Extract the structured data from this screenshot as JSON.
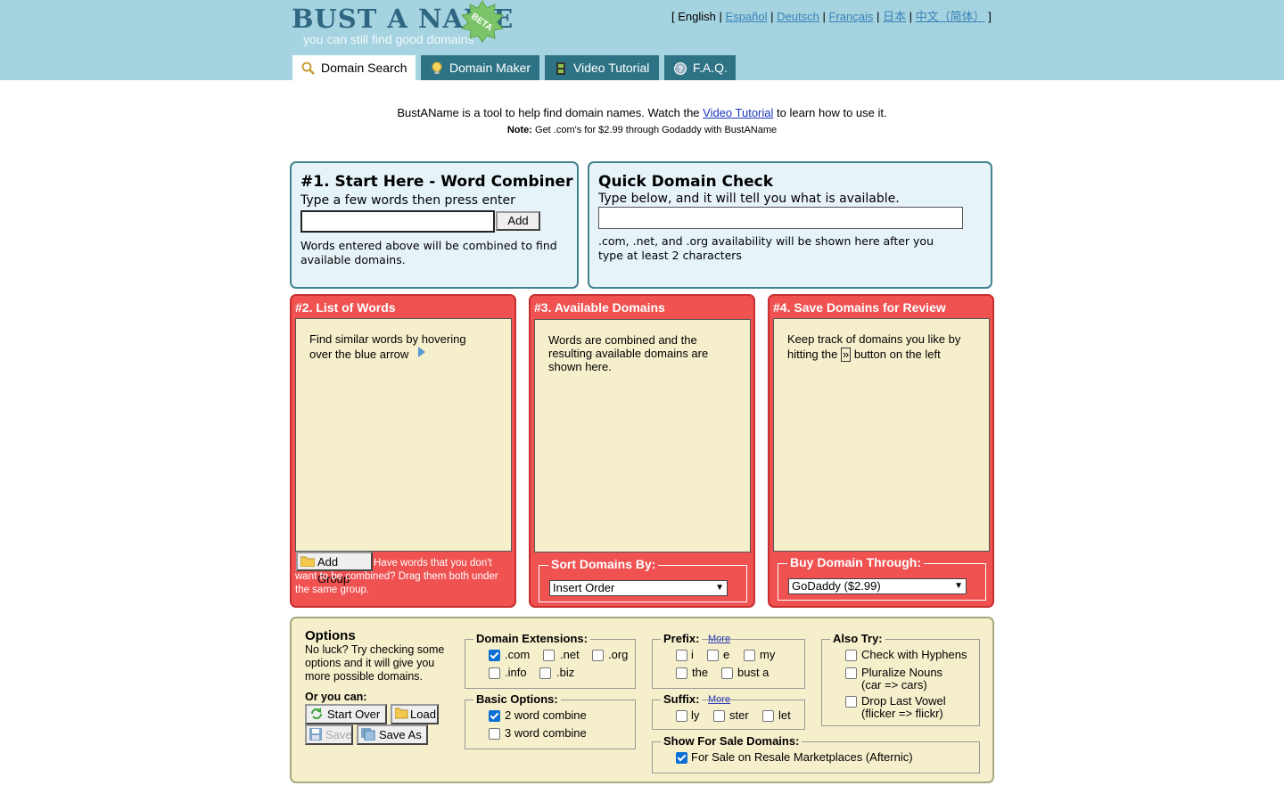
{
  "logo": {
    "main": "BUST A NAME",
    "tagline": "you can still find good domains",
    "badge": "BETA"
  },
  "languages": {
    "open": "[",
    "current": "English",
    "sep": "|",
    "items": [
      "Español",
      "Deutsch",
      "Français",
      "日本",
      "中文（简体）"
    ],
    "close": "]"
  },
  "tabs": [
    {
      "label": "Domain Search",
      "icon": "magnifier-icon"
    },
    {
      "label": "Domain Maker",
      "icon": "lightbulb-icon"
    },
    {
      "label": "Video Tutorial",
      "icon": "film-icon"
    },
    {
      "label": "F.A.Q.",
      "icon": "help-icon"
    }
  ],
  "intro": {
    "before": "BustAName is a tool to help find domain names. Watch the ",
    "link": "Video Tutorial",
    "after": " to learn how to use it."
  },
  "note": {
    "label": "Note:",
    "text": " Get .com's for $2.99 through Godaddy with BustAName"
  },
  "word_combiner": {
    "title": "#1. Start Here - Word Combiner",
    "subtitle": "Type a few words then press enter",
    "add": "Add",
    "desc": "Words entered above will be combined to find available domains."
  },
  "quick_check": {
    "title": "Quick Domain Check",
    "subtitle": "Type below, and it will tell you what is available.",
    "desc": ".com, .net, and .org availability will be shown here after you type at least 2 characters"
  },
  "list_words": {
    "title": "#2. List of Words",
    "hint": "Find similar words by hovering over the blue arrow",
    "add_group": "Add Group",
    "footer": "Have words that you don't want to be combined?  Drag them both under the same group."
  },
  "available": {
    "title": "#3. Available Domains",
    "hint": "Words are combined and the resulting available domains are shown here.",
    "sort_legend": "Sort Domains By:",
    "sort_value": "Insert Order"
  },
  "save_review": {
    "title": "#4. Save Domains for Review",
    "hint_before": "Keep track of domains you like by hitting the",
    "button": "»",
    "hint_after": "button on the left",
    "buy_legend": "Buy Domain Through:",
    "buy_value": "GoDaddy ($2.99)"
  },
  "options": {
    "title": "Options",
    "desc": "No luck?  Try checking some options and it will give you more possible domains.",
    "or_you_can": "Or you can:",
    "buttons": {
      "start_over": "Start Over",
      "load": "Load",
      "save": "Save",
      "save_as": "Save As"
    },
    "extensions": {
      "legend": "Domain Extensions:",
      "items": [
        {
          "label": ".com",
          "checked": true
        },
        {
          "label": ".net",
          "checked": false
        },
        {
          "label": ".org",
          "checked": false
        },
        {
          "label": ".info",
          "checked": false
        },
        {
          "label": ".biz",
          "checked": false
        }
      ]
    },
    "basic": {
      "legend": "Basic Options:",
      "items": [
        {
          "label": "2 word combine",
          "checked": true
        },
        {
          "label": "3 word combine",
          "checked": false
        }
      ]
    },
    "prefix": {
      "legend": "Prefix:",
      "more": "More",
      "items": [
        {
          "label": "i",
          "checked": false
        },
        {
          "label": "e",
          "checked": false
        },
        {
          "label": "my",
          "checked": false
        },
        {
          "label": "the",
          "checked": false
        },
        {
          "label": "bust a",
          "checked": false
        }
      ]
    },
    "suffix": {
      "legend": "Suffix:",
      "more": "More",
      "items": [
        {
          "label": "ly",
          "checked": false
        },
        {
          "label": "ster",
          "checked": false
        },
        {
          "label": "let",
          "checked": false
        }
      ]
    },
    "also_try": {
      "legend": "Also Try:",
      "items": [
        {
          "label": "Check with Hyphens",
          "checked": false
        },
        {
          "label": "Pluralize Nouns",
          "sub": "(car => cars)",
          "checked": false
        },
        {
          "label": "Drop Last Vowel",
          "sub": "(flicker => flickr)",
          "checked": false
        }
      ]
    },
    "for_sale": {
      "legend": "Show For Sale Domains:",
      "item": {
        "label": "For Sale on Resale Marketplaces (Afternic)",
        "checked": true
      }
    }
  }
}
